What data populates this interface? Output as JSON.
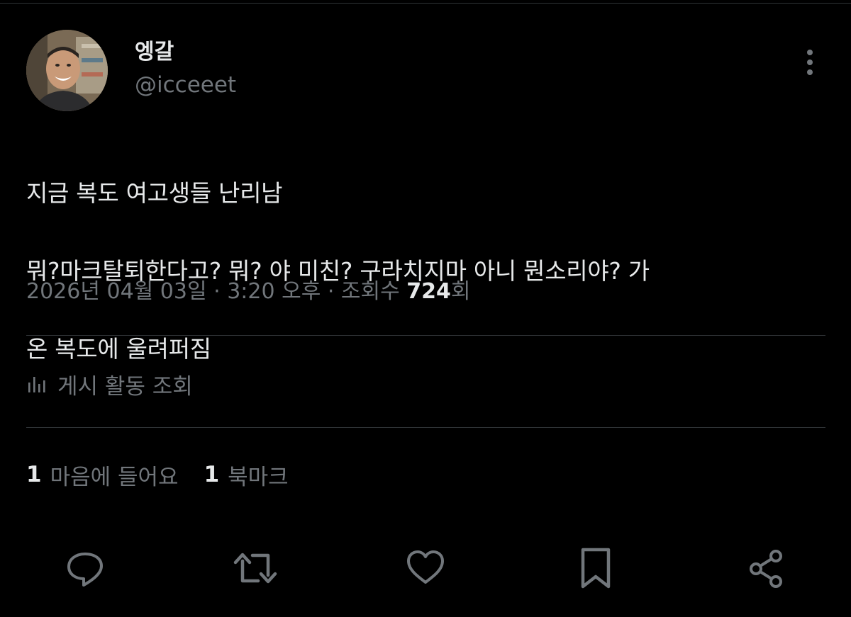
{
  "author": {
    "display_name": "엥갈",
    "handle": "@icceeet"
  },
  "tweet": {
    "line1": "지금 복도 여고생들 난리남",
    "line2": "뭐?마크탈퇴한다고? 뭐? 야 미친? 구라치지마 아니 뭔소리야? 가",
    "line3": "온 복도에 울려퍼짐"
  },
  "meta": {
    "date": "2026년 04월 03일",
    "separator1": " · ",
    "time": "3:20 오후",
    "separator2": " · ",
    "views_label": "조회수 ",
    "views_count": "724",
    "views_suffix": "회"
  },
  "activity": {
    "label": "게시 활동 조회"
  },
  "stats": {
    "likes_count": "1",
    "likes_label": "마음에 들어요",
    "bookmarks_count": "1",
    "bookmarks_label": "북마크"
  },
  "icons": {
    "more": "more-vertical-icon",
    "activity": "bar-chart-icon",
    "reply": "reply-icon",
    "retweet": "retweet-icon",
    "like": "heart-icon",
    "bookmark": "bookmark-icon",
    "share": "share-icon"
  },
  "colors": {
    "background": "#000000",
    "text_primary": "#e7e9ea",
    "text_secondary": "#71767b",
    "divider": "#2f3336"
  }
}
